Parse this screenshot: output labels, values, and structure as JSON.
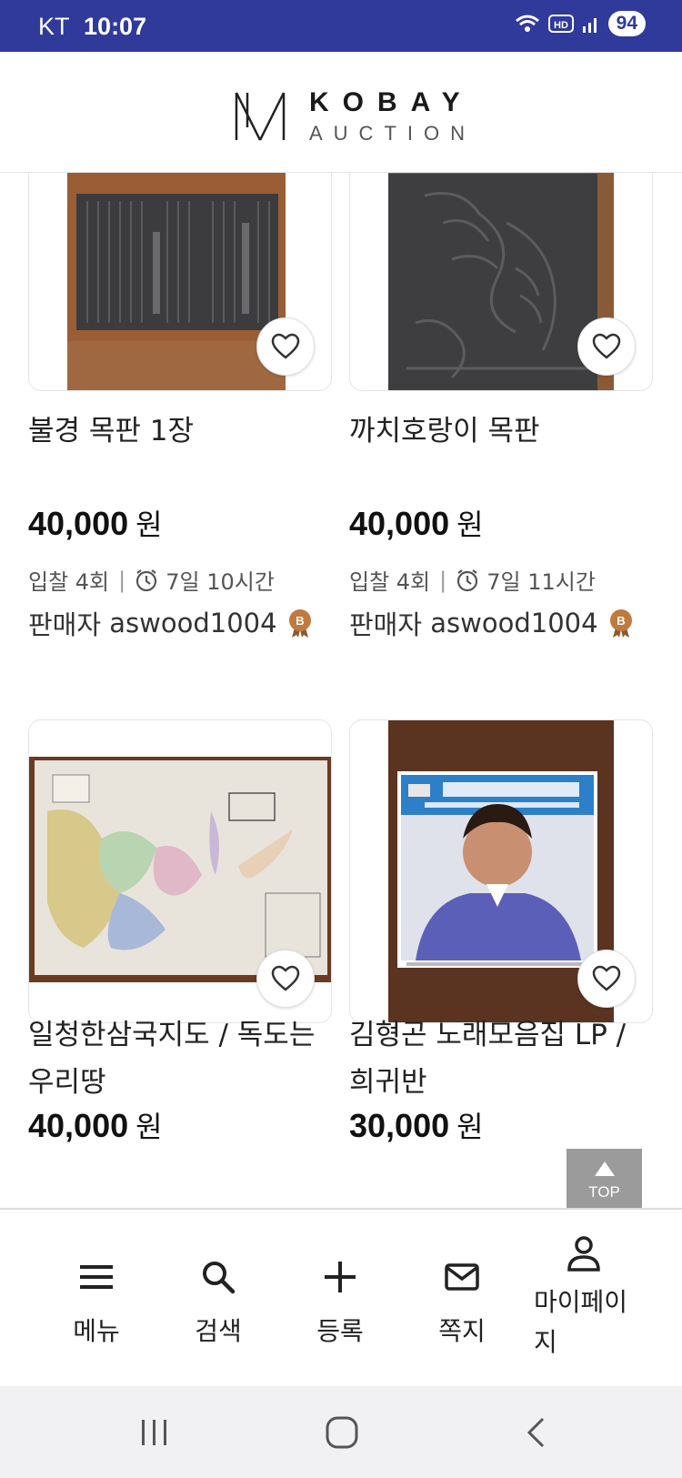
{
  "status_bar": {
    "carrier": "KT",
    "time": "10:07",
    "battery": "94"
  },
  "header": {
    "logo_main": "KOBAY",
    "logo_sub": "AUCTION"
  },
  "products": [
    {
      "title": "불경 목판 1장",
      "price": "40,000",
      "currency": "원",
      "bids": "입찰 4회",
      "time_left": "7일 10시간",
      "seller_label": "판매자",
      "seller": "aswood1004"
    },
    {
      "title": "까치호랑이 목판",
      "price": "40,000",
      "currency": "원",
      "bids": "입찰 4회",
      "time_left": "7일 11시간",
      "seller_label": "판매자",
      "seller": "aswood1004"
    },
    {
      "title": "일청한삼국지도 / 독도는 우리땅",
      "price": "40,000",
      "currency": "원"
    },
    {
      "title": "김형곤 노래모음집 LP / 희귀반",
      "price": "30,000",
      "currency": "원"
    }
  ],
  "top_button": {
    "label": "TOP"
  },
  "bottom_nav": [
    {
      "label": "메뉴",
      "icon": "menu-icon"
    },
    {
      "label": "검색",
      "icon": "search-icon"
    },
    {
      "label": "등록",
      "icon": "plus-icon"
    },
    {
      "label": "쪽지",
      "icon": "mail-icon"
    },
    {
      "label": "마이페이지",
      "icon": "person-icon"
    }
  ],
  "colors": {
    "status_bar": "#2f3a9a",
    "medal": "#c07a3e",
    "top_button": "#9b9b9b"
  }
}
